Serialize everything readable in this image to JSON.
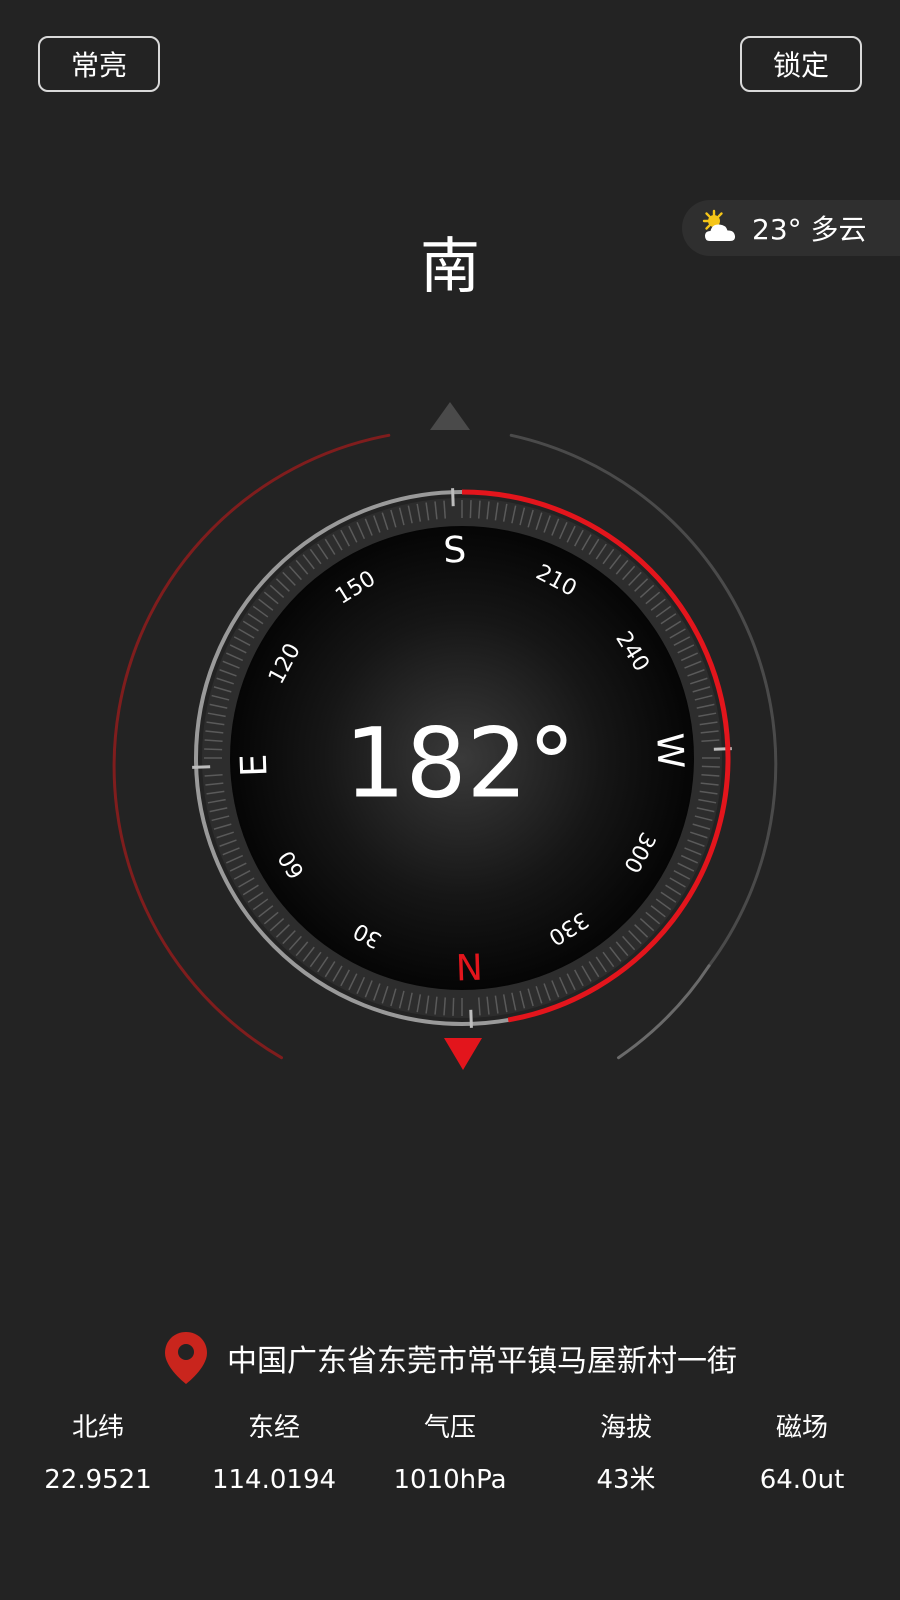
{
  "header": {
    "left_button": "常亮",
    "right_button": "锁定"
  },
  "weather": {
    "icon": "partly-cloudy-icon",
    "text": "23° 多云"
  },
  "direction": {
    "label": "南"
  },
  "compass": {
    "heading_deg": 182,
    "heading_text": "182°",
    "cardinals": [
      {
        "label": "S",
        "bearing": 180
      },
      {
        "label": "W",
        "bearing": 270
      },
      {
        "label": "N",
        "bearing": 0
      },
      {
        "label": "E",
        "bearing": 90
      }
    ],
    "degree_labels": [
      {
        "label": "150",
        "bearing": 150
      },
      {
        "label": "210",
        "bearing": 210
      },
      {
        "label": "120",
        "bearing": 120
      },
      {
        "label": "240",
        "bearing": 240
      },
      {
        "label": "60",
        "bearing": 60
      },
      {
        "label": "300",
        "bearing": 300
      },
      {
        "label": "30",
        "bearing": 30
      },
      {
        "label": "330",
        "bearing": 330
      }
    ],
    "accent_color": "#e3151c",
    "north_color": "#e3151c"
  },
  "location": {
    "icon": "location-pin-icon",
    "text": "中国广东省东莞市常平镇马屋新村一街"
  },
  "stats": [
    {
      "label": "北纬",
      "value": "22.9521"
    },
    {
      "label": "东经",
      "value": "114.0194"
    },
    {
      "label": "气压",
      "value": "1010hPa"
    },
    {
      "label": "海拔",
      "value": "43米"
    },
    {
      "label": "磁场",
      "value": "64.0ut"
    }
  ]
}
